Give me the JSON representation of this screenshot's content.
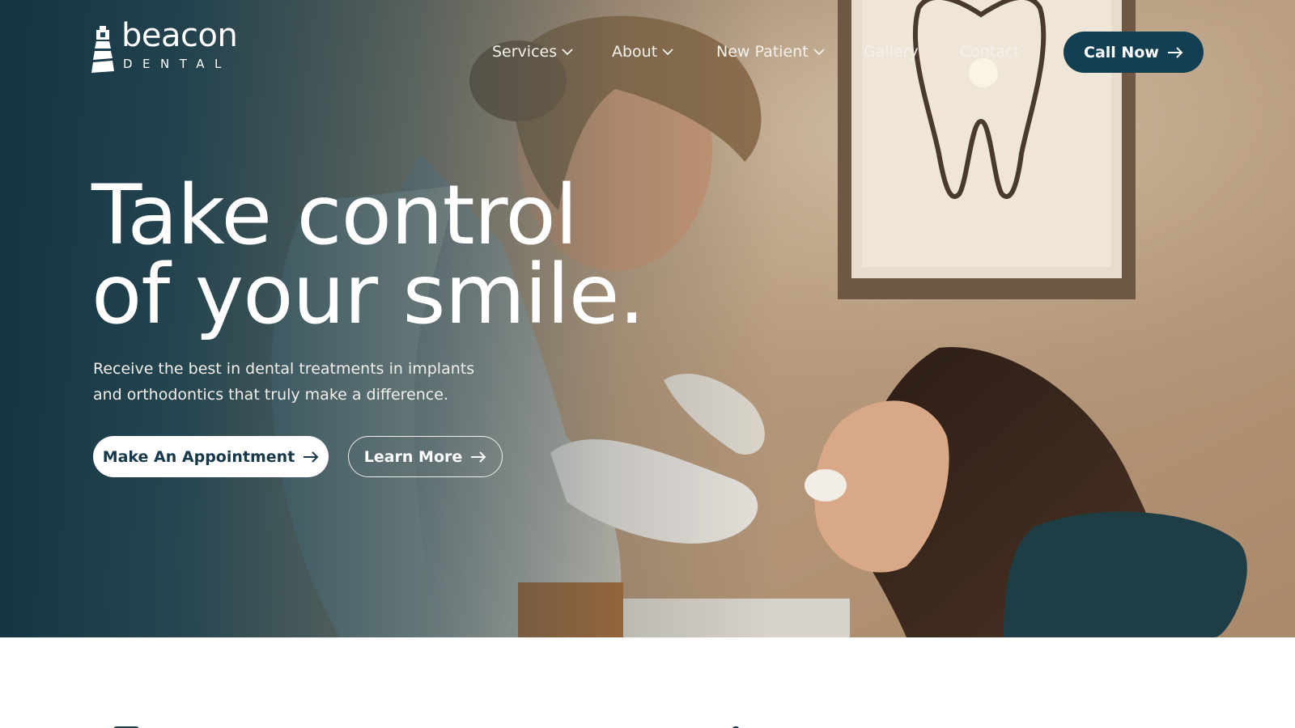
{
  "brand": {
    "name": "beacon",
    "subtitle": "DENTAL"
  },
  "nav": {
    "items": [
      {
        "label": "Services",
        "has_dropdown": true
      },
      {
        "label": "About",
        "has_dropdown": true
      },
      {
        "label": "New Patient",
        "has_dropdown": true
      },
      {
        "label": "Gallery",
        "has_dropdown": false
      },
      {
        "label": "Contact",
        "has_dropdown": false
      }
    ],
    "cta_label": "Call Now"
  },
  "hero": {
    "headline_line1": "Take control",
    "headline_line2": "of your smile.",
    "subtext_line1": "Receive the best in dental treatments in implants",
    "subtext_line2": "and orthodontics that truly make a difference.",
    "primary_button": "Make An Appointment",
    "secondary_button": "Learn More",
    "image_description_icon": "dentist-with-patient-photo"
  },
  "colors": {
    "primary": "#133f52",
    "overlay_dark": "#103242",
    "text_light": "#ffffff"
  }
}
